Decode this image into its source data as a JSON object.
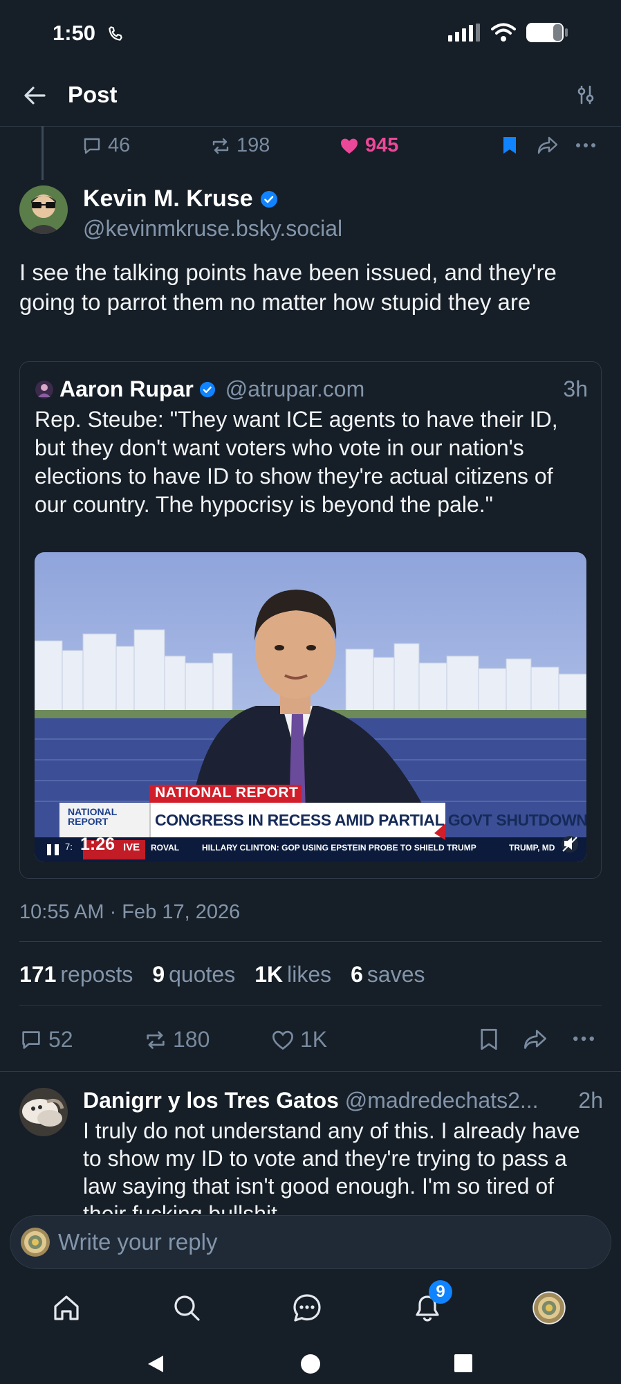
{
  "status_bar": {
    "time": "1:50",
    "call_icon": "wifi-call-icon",
    "signal_icon": "signal-icon",
    "wifi_icon": "wifi-icon",
    "battery_icon": "battery-icon"
  },
  "header": {
    "title": "Post",
    "back_icon": "arrow-left-icon",
    "filter_icon": "sliders-icon"
  },
  "parent_actions": {
    "replies": "46",
    "reposts": "198",
    "likes": "945"
  },
  "post": {
    "author_name": "Kevin M. Kruse",
    "author_handle": "@kevinmkruse.bsky.social",
    "text": "I see the talking points have been issued, and they're going to parrot them no matter how stupid they are",
    "timestamp": "10:55 AM · Feb 17, 2026",
    "quote": {
      "author_name": "Aaron Rupar",
      "author_handle": "@atrupar.com",
      "time": "3h",
      "text": "Rep. Steube: \"They want ICE agents to have their ID, but they don't want voters who vote in our nation's elections to have ID to show they're actual citizens of our country. The hypocrisy is beyond the pale.\"",
      "video": {
        "chyron_label": "NATIONAL REPORT",
        "headline": "CONGRESS IN RECESS AMID PARTIAL GOVT SHUTDOWN",
        "logo_top": "NATIONAL",
        "logo_bottom": "REPORT",
        "ticker": "HILLARY CLINTON: GOP USING EPSTEIN PROBE TO SHIELD TRUMP",
        "ticker_left": "ROVAL",
        "ticker_right": "TRUMP, MD",
        "live_label": "IVE",
        "duration": "1:26",
        "clock": "7:"
      }
    },
    "stats": {
      "reposts_count": "171",
      "reposts_label": "reposts",
      "quotes_count": "9",
      "quotes_label": "quotes",
      "likes_count": "1K",
      "likes_label": "likes",
      "saves_count": "6",
      "saves_label": "saves"
    },
    "actions": {
      "replies": "52",
      "reposts": "180",
      "likes": "1K"
    }
  },
  "reply": {
    "author_name": "Danigrr y los Tres Gatos",
    "author_handle": "@madredechats2...",
    "time": "2h",
    "text": "I truly do not understand any of this. I already have to show my ID to vote and they're trying to pass a law saying that isn't good enough. I'm so tired of their fucking bullshit."
  },
  "composer": {
    "placeholder": "Write your reply"
  },
  "nav": {
    "notifications_badge": "9",
    "items": [
      "home-icon",
      "search-icon",
      "chat-icon",
      "bell-icon",
      "profile-avatar"
    ]
  },
  "colors": {
    "background": "#161e27",
    "accent": "#1083fe",
    "like": "#ec4899",
    "muted": "#8395aa"
  }
}
